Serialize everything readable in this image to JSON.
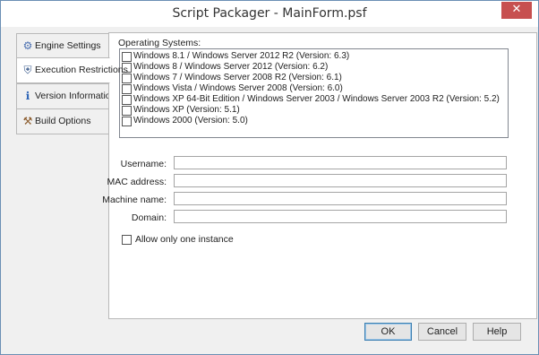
{
  "window": {
    "title": "Script Packager - MainForm.psf",
    "close_glyph": "✕"
  },
  "tabs": [
    {
      "label": "Engine Settings",
      "icon": "gear-icon",
      "glyph": "⚙"
    },
    {
      "label": "Execution Restrictions",
      "icon": "shield-icon",
      "glyph": "⛨"
    },
    {
      "label": "Version Information",
      "icon": "info-document-icon",
      "glyph": "ℹ"
    },
    {
      "label": "Build Options",
      "icon": "tools-icon",
      "glyph": "⚒"
    }
  ],
  "active_tab": "Execution Restrictions",
  "restrictions": {
    "os_label": "Operating Systems:",
    "os_items": [
      "Windows 8.1 / Windows Server 2012 R2 (Version: 6.3)",
      "Windows 8 / Windows Server 2012 (Version: 6.2)",
      "Windows 7 / Windows Server 2008 R2 (Version: 6.1)",
      "Windows Vista / Windows Server 2008 (Version: 6.0)",
      "Windows XP 64-Bit Edition / Windows Server 2003 / Windows Server 2003 R2 (Version: 5.2)",
      "Windows XP (Version: 5.1)",
      "Windows 2000 (Version: 5.0)"
    ],
    "fields": [
      {
        "label": "Username:",
        "value": ""
      },
      {
        "label": "MAC address:",
        "value": ""
      },
      {
        "label": "Machine name:",
        "value": ""
      },
      {
        "label": "Domain:",
        "value": ""
      }
    ],
    "single_instance_label": "Allow only one instance"
  },
  "buttons": {
    "ok": "OK",
    "cancel": "Cancel",
    "help": "Help"
  }
}
